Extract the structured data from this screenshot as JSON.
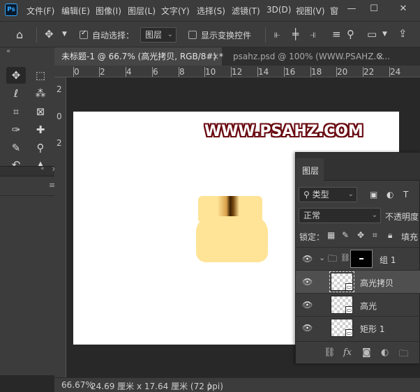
{
  "app": {
    "logo_text": "Ps"
  },
  "menu": [
    "文件(F)",
    "编辑(E)",
    "图像(I)",
    "图层(L)",
    "文字(Y)",
    "选择(S)",
    "滤镜(T)",
    "3D(D)",
    "视图(V)",
    "窗"
  ],
  "window_controls": {
    "minimize": "—",
    "maximize": "☐",
    "close": "✕"
  },
  "options_bar": {
    "auto_select_label": "自动选择：",
    "auto_select_target": "图层",
    "show_transform_label": "显示变换控件"
  },
  "tabs": [
    {
      "label": "未标题-1 @ 66.7% (高光拷贝, RGB/8#) *",
      "close": "×"
    },
    {
      "label": "psahz.psd @ 100% (WWW.PSAHZ.C...",
      "close": "×"
    }
  ],
  "ruler": {
    "h_labels": [
      "0",
      "2",
      "4",
      "6",
      "8",
      "10",
      "12",
      "14",
      "16",
      "18",
      "20",
      "22",
      "24"
    ],
    "v_labels": [
      "2",
      "0",
      "2"
    ]
  },
  "canvas": {
    "watermark": "WWW.PSAHZ.COM",
    "jar_color": "#ffe497",
    "highlight_dark": "#3c1f00"
  },
  "status": {
    "zoom": "66.67%",
    "doc_size": "24.69 厘米 x 17.64 厘米 (72 ppi)",
    "arrow": "〉"
  },
  "layers_panel": {
    "tab": "图层",
    "filter_kind": "类型",
    "blend_mode": "正常",
    "opacity_label": "不透明度",
    "lock_label": "锁定：",
    "fill_label": "填充",
    "layers": [
      {
        "name": "组 1",
        "type": "group",
        "visible": true,
        "selected": false
      },
      {
        "name": "高光拷贝",
        "type": "layer",
        "visible": true,
        "selected": true
      },
      {
        "name": "高光",
        "type": "layer",
        "visible": true,
        "selected": false
      },
      {
        "name": "矩形 1",
        "type": "layer",
        "visible": true,
        "selected": false
      }
    ]
  }
}
